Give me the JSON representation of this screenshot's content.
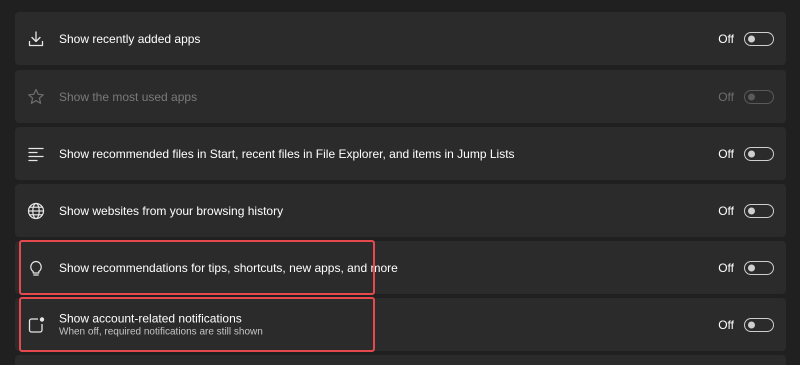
{
  "settings": [
    {
      "label": "Show recently added apps",
      "state": "Off",
      "icon": "download-icon",
      "disabled": false
    },
    {
      "label": "Show the most used apps",
      "state": "Off",
      "icon": "star-icon",
      "disabled": true
    },
    {
      "label": "Show recommended files in Start, recent files in File Explorer, and items in Jump Lists",
      "state": "Off",
      "icon": "list-icon",
      "disabled": false
    },
    {
      "label": "Show websites from your browsing history",
      "state": "Off",
      "icon": "globe-icon",
      "disabled": false
    },
    {
      "label": "Show recommendations for tips, shortcuts, new apps, and more",
      "state": "Off",
      "icon": "lightbulb-icon",
      "disabled": false
    },
    {
      "label": "Show account-related notifications",
      "sublabel": "When off, required notifications are still shown",
      "state": "Off",
      "icon": "notification-badge-icon",
      "disabled": false
    }
  ],
  "colors": {
    "background": "#202020",
    "card": "#2b2b2b",
    "highlight": "#e5484d",
    "text": "#ffffff",
    "disabled_text": "#7a7a7a"
  }
}
